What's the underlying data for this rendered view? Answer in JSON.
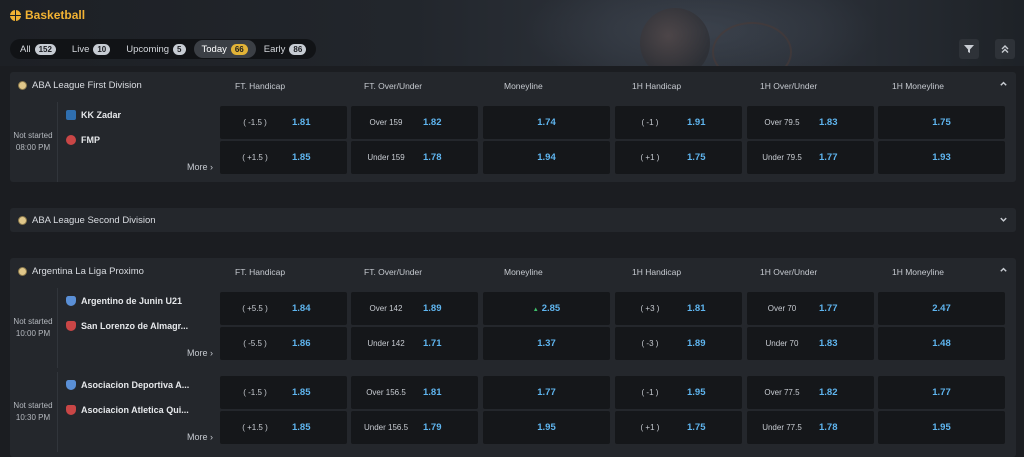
{
  "header": {
    "title": "Basketball"
  },
  "tabs": [
    {
      "label": "All",
      "count": "152"
    },
    {
      "label": "Live",
      "count": "10"
    },
    {
      "label": "Upcoming",
      "count": "5"
    },
    {
      "label": "Today",
      "count": "66"
    },
    {
      "label": "Early",
      "count": "86"
    }
  ],
  "active_tab": "Today",
  "columns": [
    "FT. Handicap",
    "FT. Over/Under",
    "Moneyline",
    "1H Handicap",
    "1H Over/Under",
    "1H Moneyline"
  ],
  "leagues": [
    {
      "name": "ABA League First Division",
      "matches": [
        {
          "status": "Not started",
          "time": "08:00 PM",
          "home": "KK Zadar",
          "away": "FMP",
          "more": "More",
          "home_row": {
            "ft_hcp": "( -1.5 )",
            "ft_hcp_odd": "1.81",
            "ft_ou": "Over 159",
            "ft_ou_odd": "1.82",
            "ml": "1.74",
            "h1_hcp": "( -1 )",
            "h1_hcp_odd": "1.91",
            "h1_ou": "Over 79.5",
            "h1_ou_odd": "1.83",
            "h1_ml": "1.75"
          },
          "away_row": {
            "ft_hcp": "( +1.5 )",
            "ft_hcp_odd": "1.85",
            "ft_ou": "Under 159",
            "ft_ou_odd": "1.78",
            "ml": "1.94",
            "h1_hcp": "( +1 )",
            "h1_hcp_odd": "1.75",
            "h1_ou": "Under 79.5",
            "h1_ou_odd": "1.77",
            "h1_ml": "1.93"
          }
        }
      ]
    },
    {
      "name": "ABA League Second Division",
      "collapsed": true
    },
    {
      "name": "Argentina La Liga Proximo",
      "matches": [
        {
          "status": "Not started",
          "time": "10:00 PM",
          "home": "Argentino de Junin U21",
          "away": "San Lorenzo de Almagr...",
          "more": "More",
          "home_row": {
            "ft_hcp": "( +5.5 )",
            "ft_hcp_odd": "1.84",
            "ft_ou": "Over 142",
            "ft_ou_odd": "1.89",
            "ml": "2.85",
            "h1_hcp": "( +3 )",
            "h1_hcp_odd": "1.81",
            "h1_ou": "Over 70",
            "h1_ou_odd": "1.77",
            "h1_ml": "2.47"
          },
          "away_row": {
            "ft_hcp": "( -5.5 )",
            "ft_hcp_odd": "1.86",
            "ft_ou": "Under 142",
            "ft_ou_odd": "1.71",
            "ml": "1.37",
            "h1_hcp": "( -3 )",
            "h1_hcp_odd": "1.89",
            "h1_ou": "Under 70",
            "h1_ou_odd": "1.83",
            "h1_ml": "1.48"
          }
        },
        {
          "status": "Not started",
          "time": "10:30 PM",
          "home": "Asociacion Deportiva A...",
          "away": "Asociacion Atletica Qui...",
          "more": "More",
          "home_row": {
            "ft_hcp": "( -1.5 )",
            "ft_hcp_odd": "1.85",
            "ft_ou": "Over 156.5",
            "ft_ou_odd": "1.81",
            "ml": "1.77",
            "h1_hcp": "( -1 )",
            "h1_hcp_odd": "1.95",
            "h1_ou": "Over 77.5",
            "h1_ou_odd": "1.82",
            "h1_ml": "1.77"
          },
          "away_row": {
            "ft_hcp": "( +1.5 )",
            "ft_hcp_odd": "1.85",
            "ft_ou": "Under 156.5",
            "ft_ou_odd": "1.79",
            "ml": "1.95",
            "h1_hcp": "( +1 )",
            "h1_hcp_odd": "1.75",
            "h1_ou": "Under 77.5",
            "h1_ou_odd": "1.78",
            "h1_ml": "1.95"
          }
        }
      ]
    }
  ],
  "colors": {
    "accent": "#f2b233",
    "odds": "#5fb5ef",
    "background": "#1b1d21",
    "cell": "#15171a"
  },
  "icons": {
    "filter": "filter-icon",
    "collapse_all": "double-chevron-up-icon",
    "expand": "chevron-up-icon",
    "collapsed": "chevron-down-icon"
  }
}
